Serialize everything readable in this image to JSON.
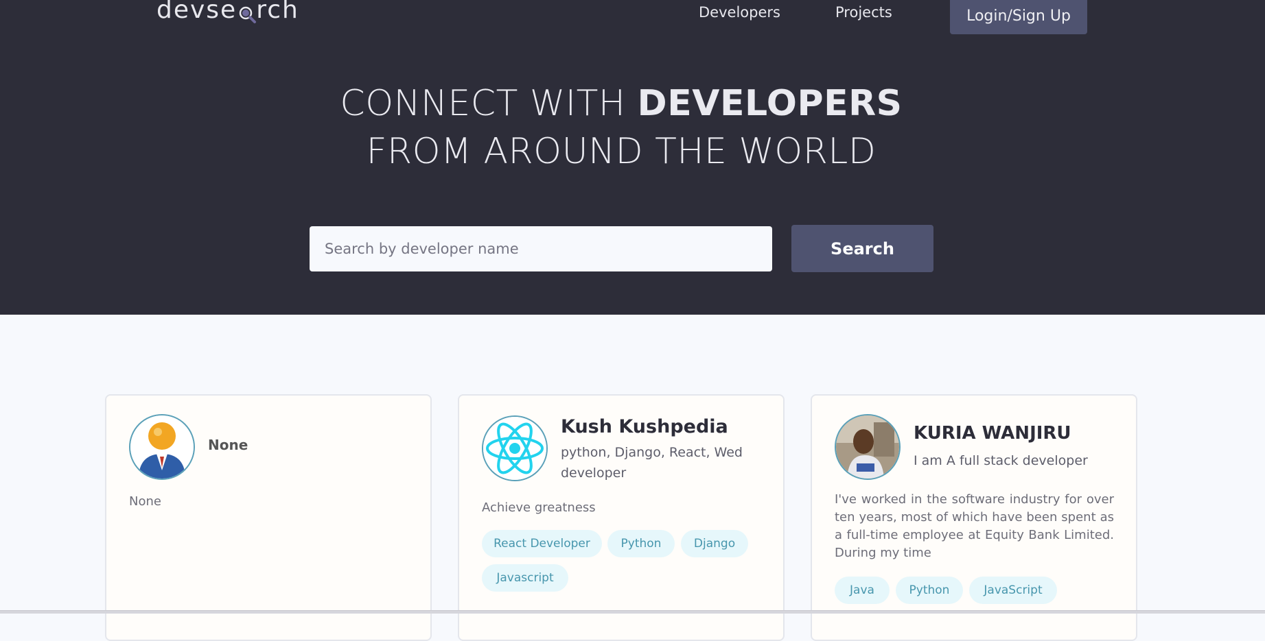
{
  "header": {
    "logo_text_before": "devse",
    "logo_text_after": "rch",
    "nav": {
      "developers": "Developers",
      "projects": "Projects",
      "login": "Login/Sign Up"
    }
  },
  "hero": {
    "title_light_1": "CONNECT WITH ",
    "title_bold": "DEVELOPERS",
    "title_line_2": "FROM AROUND THE WORLD"
  },
  "search": {
    "placeholder": "Search by developer name",
    "button_label": "Search"
  },
  "developers": [
    {
      "name": "None",
      "short_intro": "",
      "bio": "None",
      "avatar": "default-user-icon",
      "skills": []
    },
    {
      "name": "Kush Kushpedia",
      "short_intro": "python, Django, React, Wed developer",
      "bio": "Achieve greatness",
      "avatar": "react-logo-icon",
      "skills": [
        "React Developer",
        "Python",
        "Django",
        "Javascript"
      ]
    },
    {
      "name": "KURIA WANJIRU",
      "short_intro": "I am A full stack developer",
      "bio": "I've worked in the software industry for over ten years, most of which have been spent as a full-time employee at Equity Bank Limited. During my time",
      "avatar": "profile-photo",
      "skills": [
        "Java",
        "Python",
        "JavaScript"
      ]
    }
  ],
  "colors": {
    "hero_bg": "#2d2d39",
    "button_bg": "#4f5370",
    "tag_bg": "#e6f7fb",
    "tag_text": "#4796ad"
  }
}
